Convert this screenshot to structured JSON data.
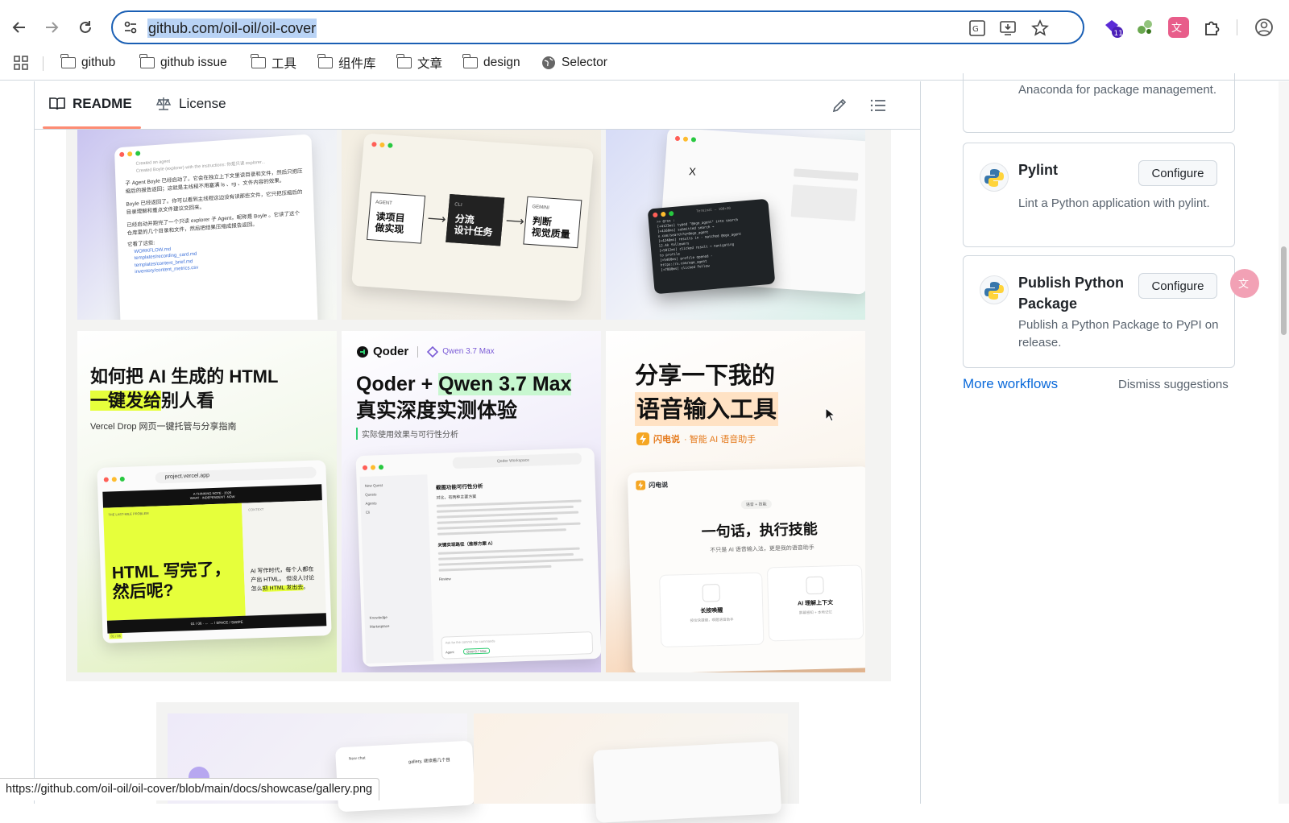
{
  "browser": {
    "url": "github.com/oil-oil/oil-cover",
    "ext_badge": "11",
    "bookmarks": [
      "github",
      "github issue",
      "工具",
      "组件库",
      "文章",
      "design",
      "Selector"
    ]
  },
  "readme": {
    "tab_readme": "README",
    "tab_license": "License"
  },
  "gallery": {
    "t1": {
      "header": "Created an agent",
      "line2": "Created Boyle (explorer) with the instructions: 你是只读 explorer...",
      "p1": "子 Agent Boyle 已经启动了。它会在独立上下文里读目录和文件，然后只把压缩后的报告返回；这就是主线程不用塞满 ls 、rg 、文件内容的效果。",
      "p2": "Boyle 已经返回了。你可以看到主线程这边没有读那些文件，它只把压缩后的目录理解和重点文件建议交回来。",
      "p3": "已经启动并跑完了一个只读 explorer 子 Agent，昵称是 Boyle 。它读了这个仓库里的几个目录和文件，然后把结果压缩成报告返回。",
      "list_title": "它看了这些:",
      "files": [
        "WORKFLOW.md",
        "templates/recording_card.md",
        "templates/content_brief.md",
        "inventory/content_metrics.csv"
      ]
    },
    "t2": {
      "boxes": [
        {
          "tag": "AGENT",
          "text": "读项目\n做实现"
        },
        {
          "tag": "CLI",
          "text": "分流\n设计任务"
        },
        {
          "tag": "GEMINI",
          "text": "判断\n视觉质量"
        }
      ]
    },
    "t3": {
      "x_mark": "X",
      "terminal_title": "Terminal — 100×30",
      "terminal_lines": [
        ">> @rsx :",
        "[+4123ms] typed \"@ego_agent\" into search",
        "[+4160ms] submitted search →",
        "x.com/search?q=@ego_agent",
        "[+4240ms] results in - matched @ego_agent",
        "12.4k followers",
        "[+5012ms] clicked result → navigating",
        "to profile",
        "[+5480ms] profile opened -",
        "https://x.com/ego_agent",
        "[+7880ms] clicked Follow"
      ]
    },
    "t4": {
      "title_line1": "如何把 AI 生成的 HTML",
      "title_hl": "一键发给",
      "title_rest": "别人看",
      "subtitle": "Vercel Drop 网页一键托管与分享指南",
      "url": "project.vercel.app",
      "banner": "A THINKING NOTE · 2026",
      "banner_sub": "WHAT · INDEPENDENT ·NOW",
      "kicker": "THE LAST-MILE PROBLEM",
      "context": "CONTEXT",
      "big1": "HTML 写完了，",
      "big2": "然后呢?",
      "side1": "AI 写作时代，每个人都在产出 HTML。",
      "side2": "但没人讨论怎么",
      "side_hl": "把 HTML 发出去",
      "side_end": "。",
      "footer": "01 / 06 · ← → / SPACE / SWIPE",
      "page": "01 / 06"
    },
    "t5": {
      "brand": "Qoder",
      "partner": "Qwen 3.7 Max",
      "title1a": "Qoder + ",
      "title1_hl": "Qwen 3.7 Max",
      "title2": "真实深度实测体验",
      "subtitle": "实际使用效果与可行性分析",
      "win_title": "Qoder Workspace",
      "nav_new": "New Quest",
      "nav_items": [
        "Quests",
        "Agents",
        "Cli",
        "Knowledge",
        "Marketplace"
      ],
      "doc_title": "截图功能可行性分析",
      "doc_sub": "对比，有两种主要方案",
      "doc_section": "关键实现路径（推荐方案 A）",
      "review": "Review",
      "chip_agent": "Agent",
      "chip_model": "Qwen3.7 Max",
      "input_ph": "Ask for the commit / for commands"
    },
    "t6": {
      "title1": "分享一下我的",
      "title2": "语音输入工具",
      "brand": "闪电说",
      "tagline": "· 智能 AI 语音助手",
      "card_brand": "闪电说",
      "pill": "语音 + 技能",
      "big": "一句话，执行技能",
      "sub": "不只是 AI 语音输入法，更是我的语音助手",
      "f1": "长按唤醒",
      "f1_sub": "按住快捷键，唤醒语音助手",
      "f2": "AI 理解上下文",
      "f2_sub": "屏幕感知 + 本地记忆"
    },
    "bottom_strip": {
      "chat_label": "New chat",
      "side_text": "gallery, 继续看几个目"
    }
  },
  "sidebar": {
    "partial_desc": "Anaconda for package management.",
    "workflows": [
      {
        "title": "Pylint",
        "desc": "Lint a Python application with pylint.",
        "button": "Configure"
      },
      {
        "title": "Publish Python Package",
        "desc": "Publish a Python Package to PyPI on release.",
        "button": "Configure"
      }
    ],
    "more_workflows": "More workflows",
    "dismiss": "Dismiss suggestions"
  },
  "status_url": "https://github.com/oil-oil/oil-cover/blob/main/docs/showcase/gallery.png",
  "colors": {
    "accent_link": "#0969da",
    "tab_underline": "#fd8c73",
    "omnibox_focus": "#1a5fb4"
  }
}
